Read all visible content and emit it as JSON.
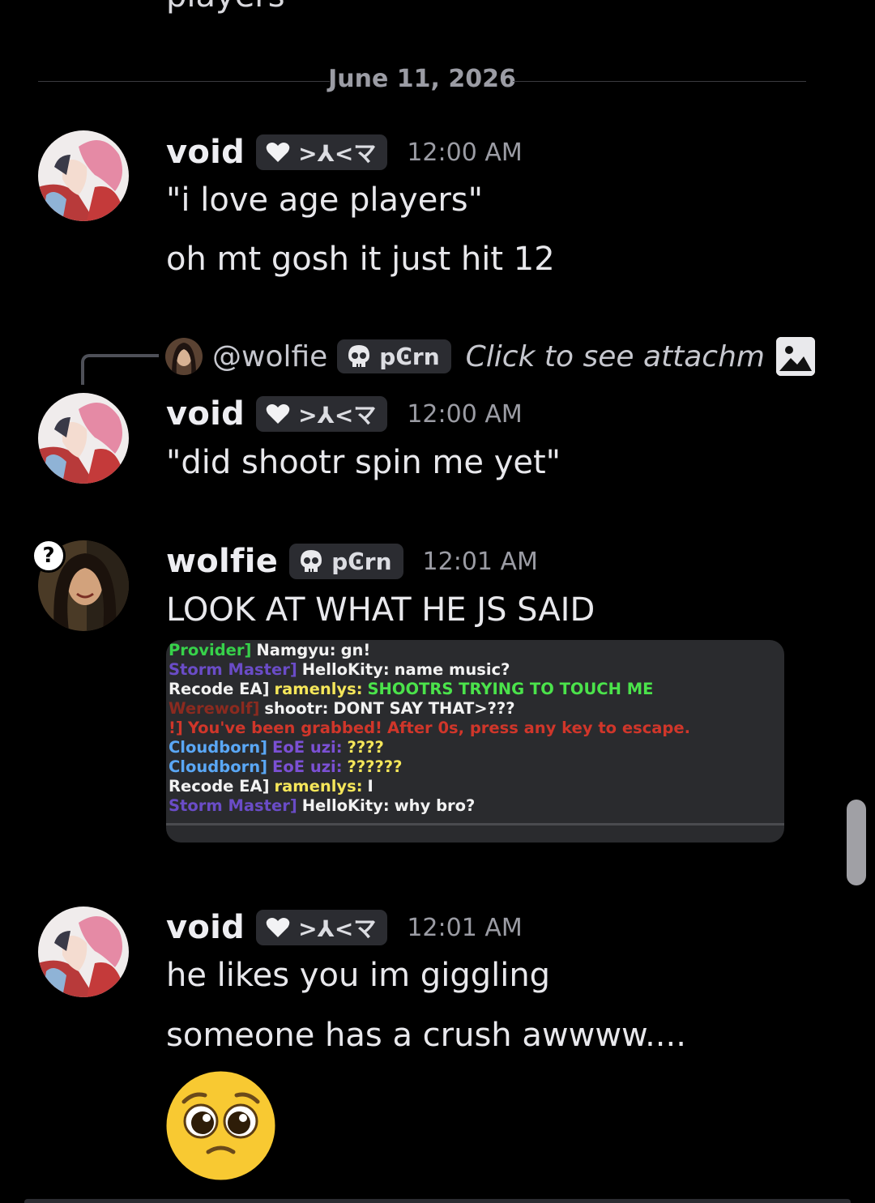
{
  "top_partial_text": "players",
  "date_divider": "June 11, 2026",
  "messages": [
    {
      "author": "void",
      "tag": ">⅄<マ",
      "time": "12:00 AM",
      "lines": [
        "\"i love age players\"",
        "oh mt gosh it just hit 12"
      ]
    },
    {
      "reply": {
        "author": "@wolfie",
        "tag": "pϾrn",
        "preview": "Click to see attachm"
      },
      "author": "void",
      "tag": ">⅄<マ",
      "time": "12:00 AM",
      "lines": [
        "\"did shootr spin me yet\""
      ]
    },
    {
      "author": "wolfie",
      "tag": "pϾrn",
      "time": "12:01 AM",
      "lines": [
        "LOOK AT WHAT HE JS SAID"
      ],
      "attachment_lines": [
        {
          "prefix": "Provider]",
          "prefix_color": "#37d14a",
          "name": "Namgyu:",
          "name_color": "#f2f2f2",
          "text": "gn!",
          "text_color": "#f2f2f2"
        },
        {
          "prefix": "Storm Master]",
          "prefix_color": "#6a4cc7",
          "name": "HelloKity:",
          "name_color": "#f2f2f2",
          "text": "name music?",
          "text_color": "#f2f2f2"
        },
        {
          "prefix": "Recode EA]",
          "prefix_color": "#f2f2f2",
          "name": "ramenlys:",
          "name_color": "#f5e65a",
          "text": "SHOOTRS TRYING TO TOUCH ME",
          "text_color": "#4be34b"
        },
        {
          "prefix": "Werewolf]",
          "prefix_color": "#8b2a1f",
          "name": "shootr:",
          "name_color": "#f2f2f2",
          "text": "DONT SAY THAT>???",
          "text_color": "#f2f2f2"
        },
        {
          "prefix": "!]",
          "prefix_color": "#d0362a",
          "name": "You've been grabbed!",
          "name_color": "#d0362a",
          "text": "After 0s, press any key to escape.",
          "text_color": "#d0362a"
        },
        {
          "prefix": "Cloudborn]",
          "prefix_color": "#5aa7f5",
          "name": "EoE uzi:",
          "name_color": "#7b50d4",
          "text": "????",
          "text_color": "#f5e65a"
        },
        {
          "prefix": "Cloudborn]",
          "prefix_color": "#5aa7f5",
          "name": "EoE uzi:",
          "name_color": "#7b50d4",
          "text": "??????",
          "text_color": "#f5e65a"
        },
        {
          "prefix": "Recode EA]",
          "prefix_color": "#f2f2f2",
          "name": "ramenlys:",
          "name_color": "#f5e65a",
          "text": "I",
          "text_color": "#f2f2f2"
        },
        {
          "prefix": "Storm Master]",
          "prefix_color": "#6a4cc7",
          "name": "HelloKity:",
          "name_color": "#f2f2f2",
          "text": "why bro?",
          "text_color": "#f2f2f2"
        }
      ]
    },
    {
      "author": "void",
      "tag": ">⅄<マ",
      "time": "12:01 AM",
      "lines": [
        "he likes you im giggling",
        "someone has a crush awwww...."
      ],
      "emoji": "pleading-face"
    }
  ],
  "status_badge": "?",
  "colors": {
    "background": "#000000",
    "tag_bg": "#2b2c31",
    "muted_text": "#9b9ca4"
  }
}
